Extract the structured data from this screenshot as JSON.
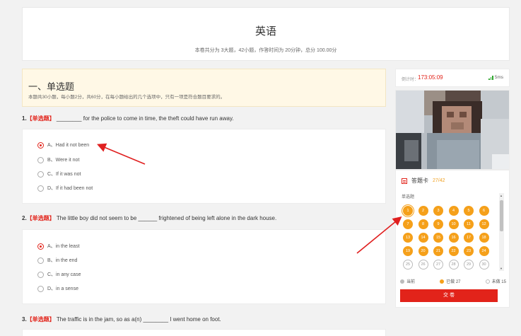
{
  "header": {
    "title": "英语",
    "summary": "本卷共分为 3大题，42小题，作答时间为 20分钟，总分 100.00分"
  },
  "section": {
    "title": "一、单选题",
    "description": "本题共30小题，每小题2分，共60分，在每小题给出的几个选项中，只有一项是符合题目要求的。"
  },
  "questions": [
    {
      "number": "1.",
      "tag": "【单选题】",
      "stem": "________ for the police to come in time, the theft could have run away.",
      "selected_index": 0,
      "options": [
        "A、Had it not been",
        "B、Were it not",
        "C、If it was not",
        "D、If it had been not"
      ]
    },
    {
      "number": "2.",
      "tag": "【单选题】",
      "stem": "The little boy did not seem to be ______ frightened of being left alone in the dark house.",
      "selected_index": 0,
      "options": [
        "A、in the least",
        "B、in the end",
        "C、in any case",
        "D、in a sense"
      ]
    },
    {
      "number": "3.",
      "tag": "【单选题】",
      "stem": "The traffic is in the jam, so as a(n) ________ I went home on foot."
    }
  ],
  "sidebar": {
    "timer_label": "倒计时：",
    "timer_value": "173:05:09",
    "signal_text": "5ms",
    "card_title": "答题卡",
    "card_progress": "27/42",
    "grid_label": "单选题",
    "answered_numbers": [
      "1",
      "2",
      "3",
      "4",
      "5",
      "6",
      "7",
      "8",
      "9",
      "10",
      "11",
      "12",
      "13",
      "14",
      "15",
      "16",
      "17",
      "18",
      "19",
      "20",
      "21",
      "22",
      "23",
      "24"
    ],
    "unanswered_numbers": [
      "25",
      "26",
      "27",
      "28",
      "29",
      "30"
    ],
    "current_number": "1",
    "legend": {
      "current": "当前",
      "answered": "已做 27",
      "unanswered": "未做 15"
    },
    "submit_label": "交 卷"
  },
  "colors": {
    "accent": "#e2231a",
    "answered": "#f5a01a",
    "signal": "#2aa52a",
    "banner": "#fff8e6"
  }
}
